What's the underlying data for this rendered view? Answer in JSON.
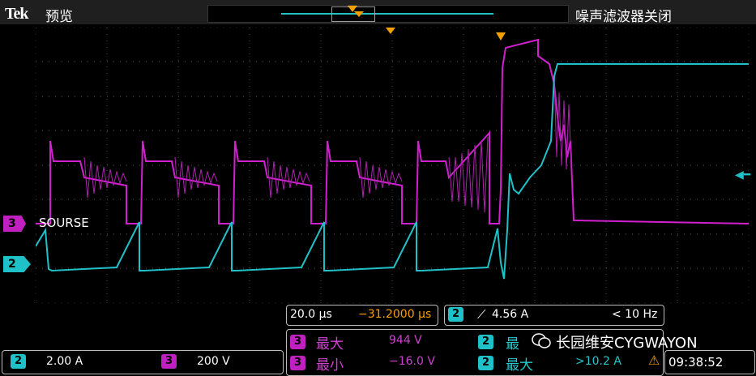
{
  "topbar": {
    "brand": "Tek",
    "mode": "预览",
    "noise_filter": "噪声滤波器关闭"
  },
  "channel_labels": {
    "ch3_number": "3",
    "ch3_name": "SOURSE",
    "ch2_number": "2"
  },
  "timebase": {
    "scale": "20.0 µs",
    "position": "−31.2000 µs"
  },
  "trigger": {
    "channel": "2",
    "level": "4.56 A",
    "frequency": "< 10 Hz"
  },
  "scales": {
    "ch2_number": "2",
    "ch2_scale": "2.00 A",
    "ch3_number": "3",
    "ch3_scale": "200 V"
  },
  "measurements": {
    "row1": {
      "channel": "3",
      "label": "最大",
      "value": "944 V"
    },
    "row2": {
      "channel": "3",
      "label": "最小",
      "value": "−16.0 V"
    },
    "row3": {
      "channel": "2",
      "label": "最"
    },
    "row4": {
      "channel": "2",
      "label": "最大",
      "value": ">10.2 A"
    }
  },
  "clock": "09:38:52",
  "watermark": "长园维安CYGWAYON",
  "colors": {
    "ch2": "#20c0c8",
    "ch3": "#c020c0",
    "trigger": "#f2a000",
    "background": "#000000"
  }
}
